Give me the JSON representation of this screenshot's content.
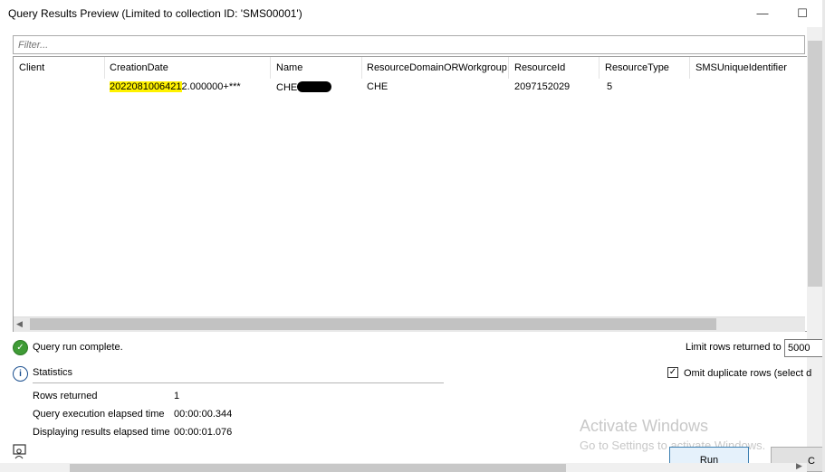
{
  "window": {
    "title": "Query Results Preview (Limited to collection ID: 'SMS00001')",
    "minimize_glyph": "—",
    "maximize_glyph": "☐",
    "maximize_icon": "maximize-icon",
    "minimize_icon": "minimize-icon"
  },
  "filter": {
    "placeholder": "Filter..."
  },
  "grid": {
    "columns": [
      "Client",
      "CreationDate",
      "Name",
      "ResourceDomainORWorkgroup",
      "ResourceId",
      "ResourceType",
      "SMSUniqueIdentifier"
    ],
    "rows": [
      {
        "client": "",
        "creation_date_highlighted": "2022081006421",
        "creation_date_rest": "2.000000+***",
        "name_visible": "CHE",
        "resource_domain": "CHE",
        "resource_id": "2097152029",
        "resource_type": "5",
        "sms_unique_identifier": ""
      }
    ],
    "highlight_color": "#fff200",
    "redaction_color": "#000000"
  },
  "status": {
    "message": "Query run complete.",
    "icon": "check-circle-icon",
    "icon_color": "#3f9b36"
  },
  "limit": {
    "label": "Limit rows returned to",
    "value": "5000"
  },
  "omit_duplicates": {
    "label": "Omit duplicate rows (select d",
    "checked": true,
    "check_glyph": "✓"
  },
  "statistics": {
    "heading": "Statistics",
    "icon": "info-icon",
    "icon_glyph": "i",
    "rows": [
      {
        "label": "Rows returned",
        "value": "1"
      },
      {
        "label": "Query execution elapsed time",
        "value": "00:00:00.344"
      },
      {
        "label": "Displaying results elapsed time",
        "value": "00:00:01.076"
      }
    ]
  },
  "watermark": {
    "line1": "Activate Windows",
    "line2": "Go to Settings to activate Windows."
  },
  "buttons": {
    "run": "Run",
    "cancel": "C"
  }
}
